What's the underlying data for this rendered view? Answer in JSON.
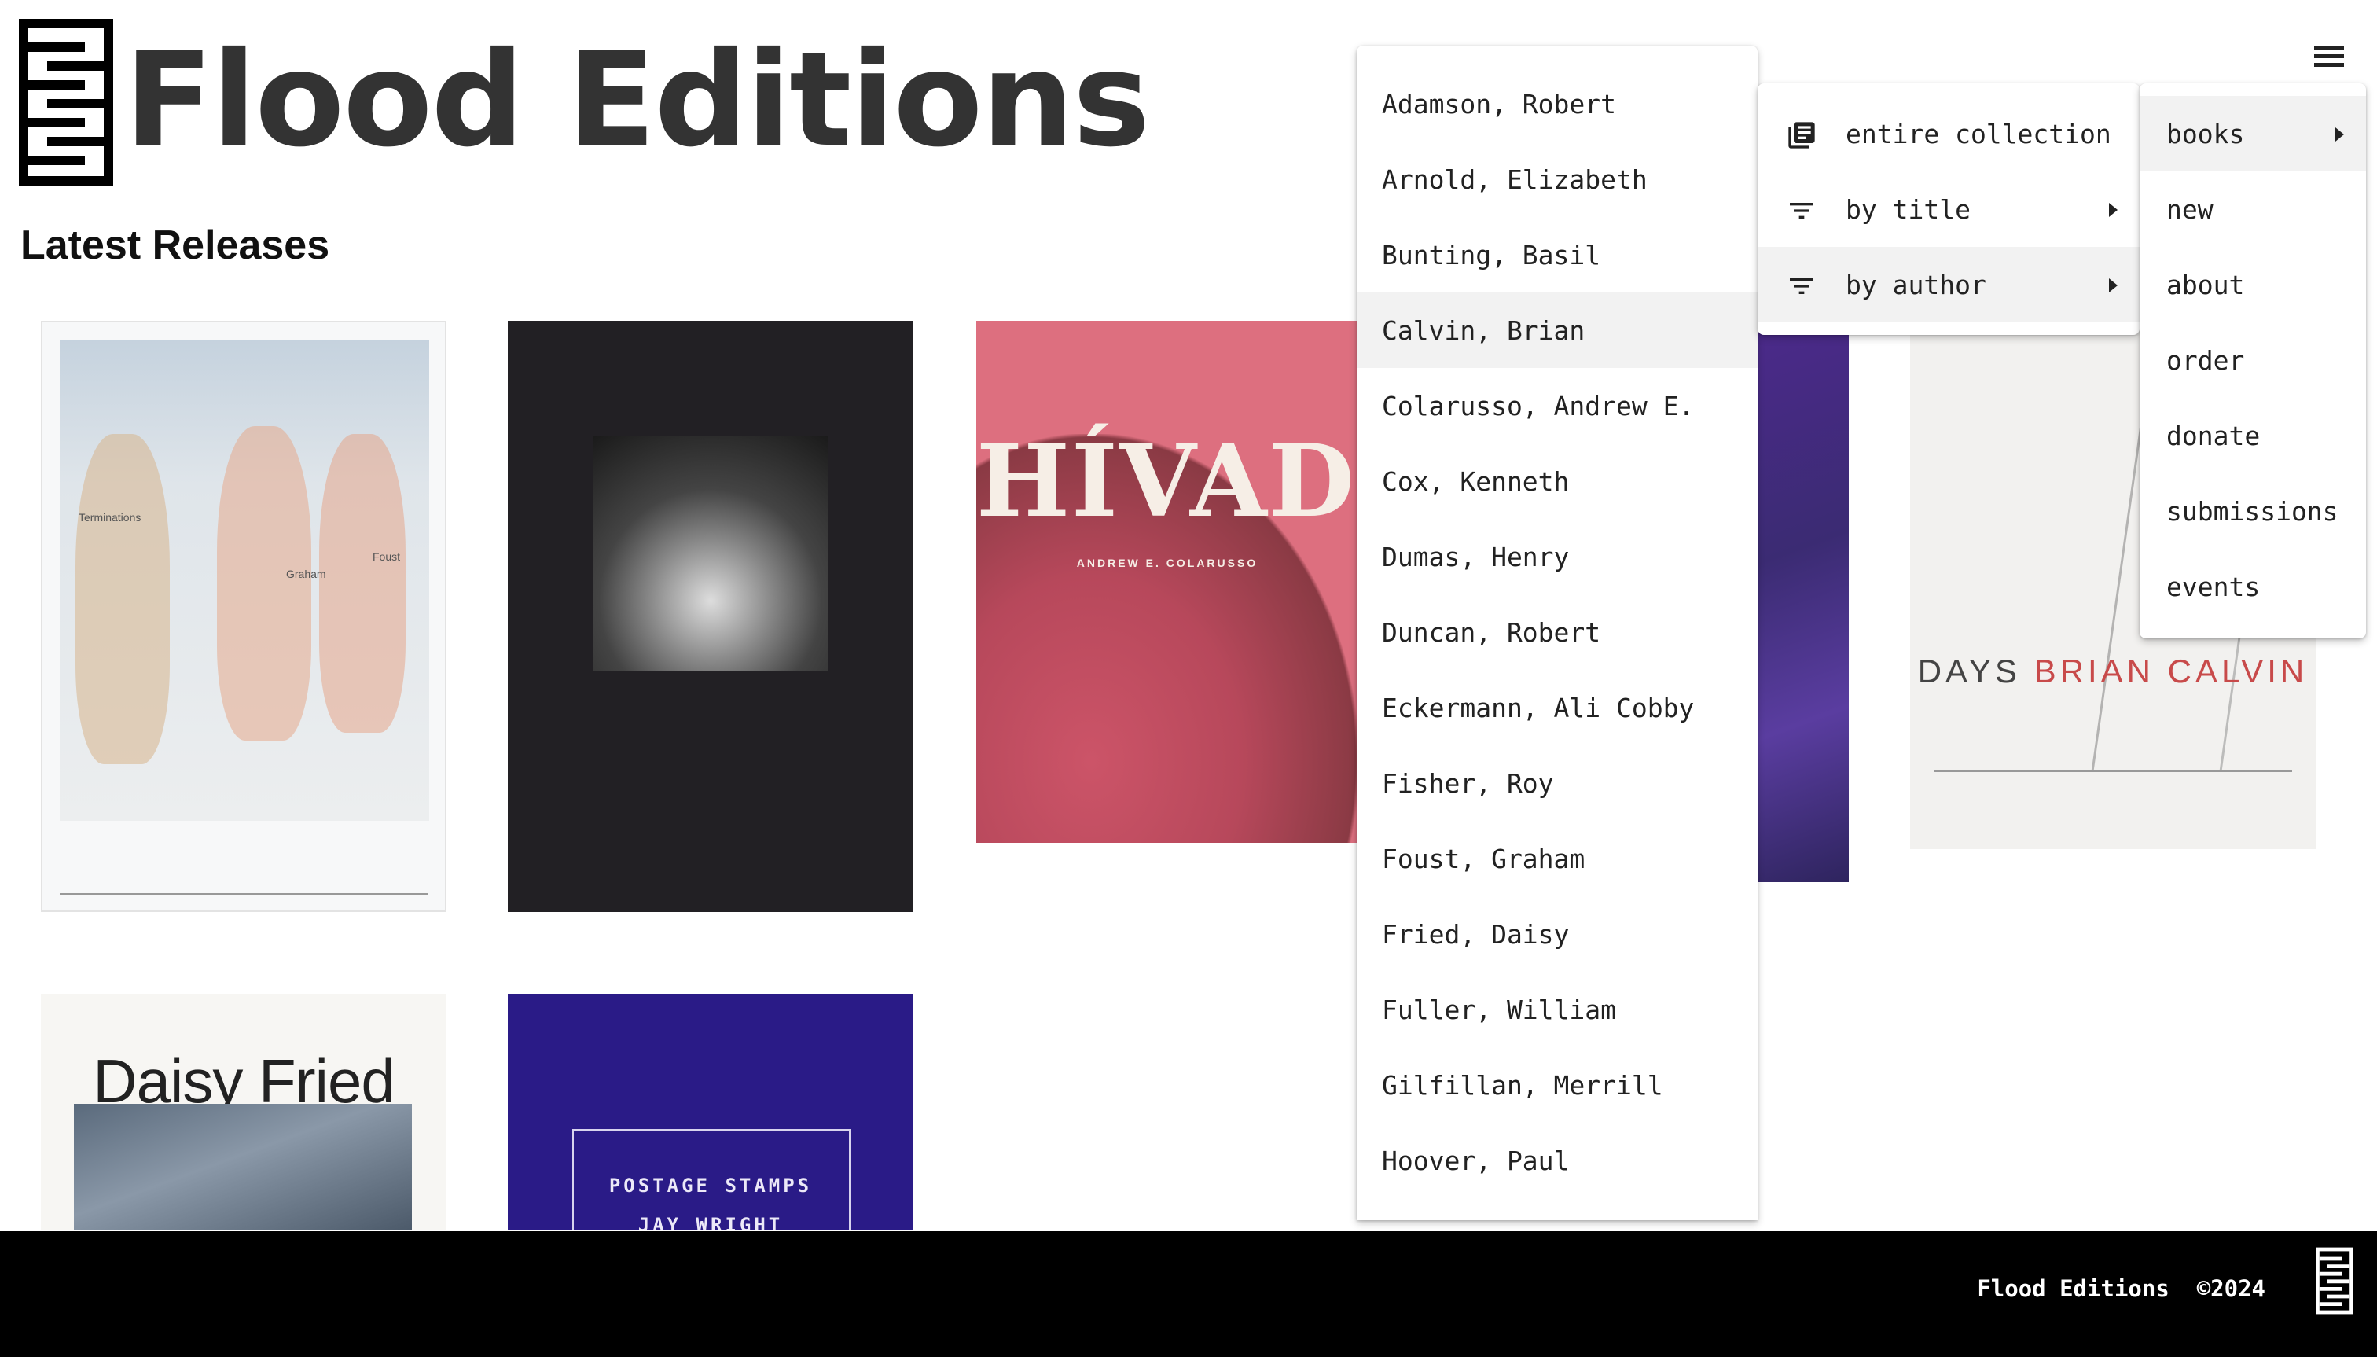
{
  "header": {
    "site_title": "Flood Editions",
    "logo_icon": "flood-editions-logo-icon",
    "menu_icon": "hamburger-menu-icon"
  },
  "main": {
    "section_title": "Latest Releases",
    "books": [
      {
        "cover_text": [
          "Terminations",
          "Graham",
          "Foust"
        ]
      },
      {
        "cover_text": []
      },
      {
        "title": "HÍVADO",
        "author": "ANDREW E. COLARUSSO"
      },
      {
        "cover_text": []
      },
      {
        "title": "DAYS",
        "author": "BRIAN CALVIN"
      },
      {
        "title": "Daisy Fried"
      },
      {
        "title": "POSTAGE STAMPS",
        "author": "JAY WRIGHT"
      }
    ]
  },
  "main_menu": {
    "items": [
      {
        "label": "books",
        "has_submenu": true,
        "active": true
      },
      {
        "label": "new"
      },
      {
        "label": "about"
      },
      {
        "label": "order"
      },
      {
        "label": "donate"
      },
      {
        "label": "submissions"
      },
      {
        "label": "events"
      }
    ]
  },
  "books_menu": {
    "items": [
      {
        "label": "entire collection",
        "icon": "library-books-icon"
      },
      {
        "label": "by title",
        "icon": "filter-list-icon",
        "has_submenu": true
      },
      {
        "label": "by author",
        "icon": "filter-list-icon",
        "has_submenu": true,
        "active": true
      }
    ]
  },
  "author_menu": {
    "items": [
      "Adamson, Robert",
      "Arnold, Elizabeth",
      "Bunting, Basil",
      "Calvin, Brian",
      "Colarusso, Andrew E.",
      "Cox, Kenneth",
      "Dumas, Henry",
      "Duncan, Robert",
      "Eckermann, Ali Cobby",
      "Fisher, Roy",
      "Foust, Graham",
      "Fried, Daisy",
      "Fuller, William",
      "Gilfillan, Merrill",
      "Hoover, Paul"
    ],
    "active_index": 3
  },
  "footer": {
    "text": "Flood Editions  ©2024"
  },
  "colors": {
    "footer_bg": "#000000",
    "menu_hover": "#f2f2f2",
    "title_text": "#333333"
  }
}
